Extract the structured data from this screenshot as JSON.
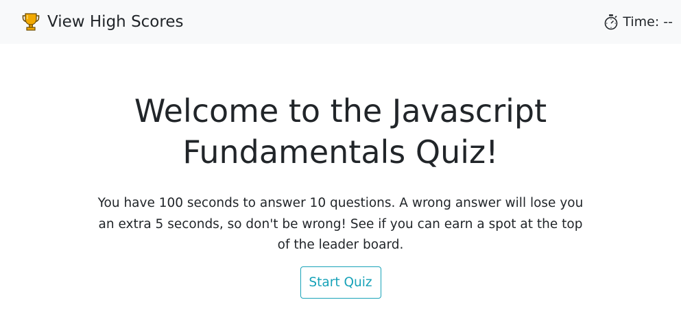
{
  "nav": {
    "high_scores_label": "View High Scores",
    "trophy_icon": "trophy-icon",
    "timer_icon": "stopwatch-icon",
    "timer_text": "Time: --"
  },
  "main": {
    "title": "Welcome to the Javascript Fundamentals Quiz!",
    "intro": "You have 100 seconds to answer 10 questions. A wrong answer will lose you an extra 5 seconds, so don't be wrong! See if you can earn a spot at the top of the leader board.",
    "start_button_label": "Start Quiz"
  },
  "colors": {
    "navbar_bg": "#f8f9fa",
    "text": "#212529",
    "accent": "#17a2b8",
    "trophy_gold": "#f5b400"
  }
}
